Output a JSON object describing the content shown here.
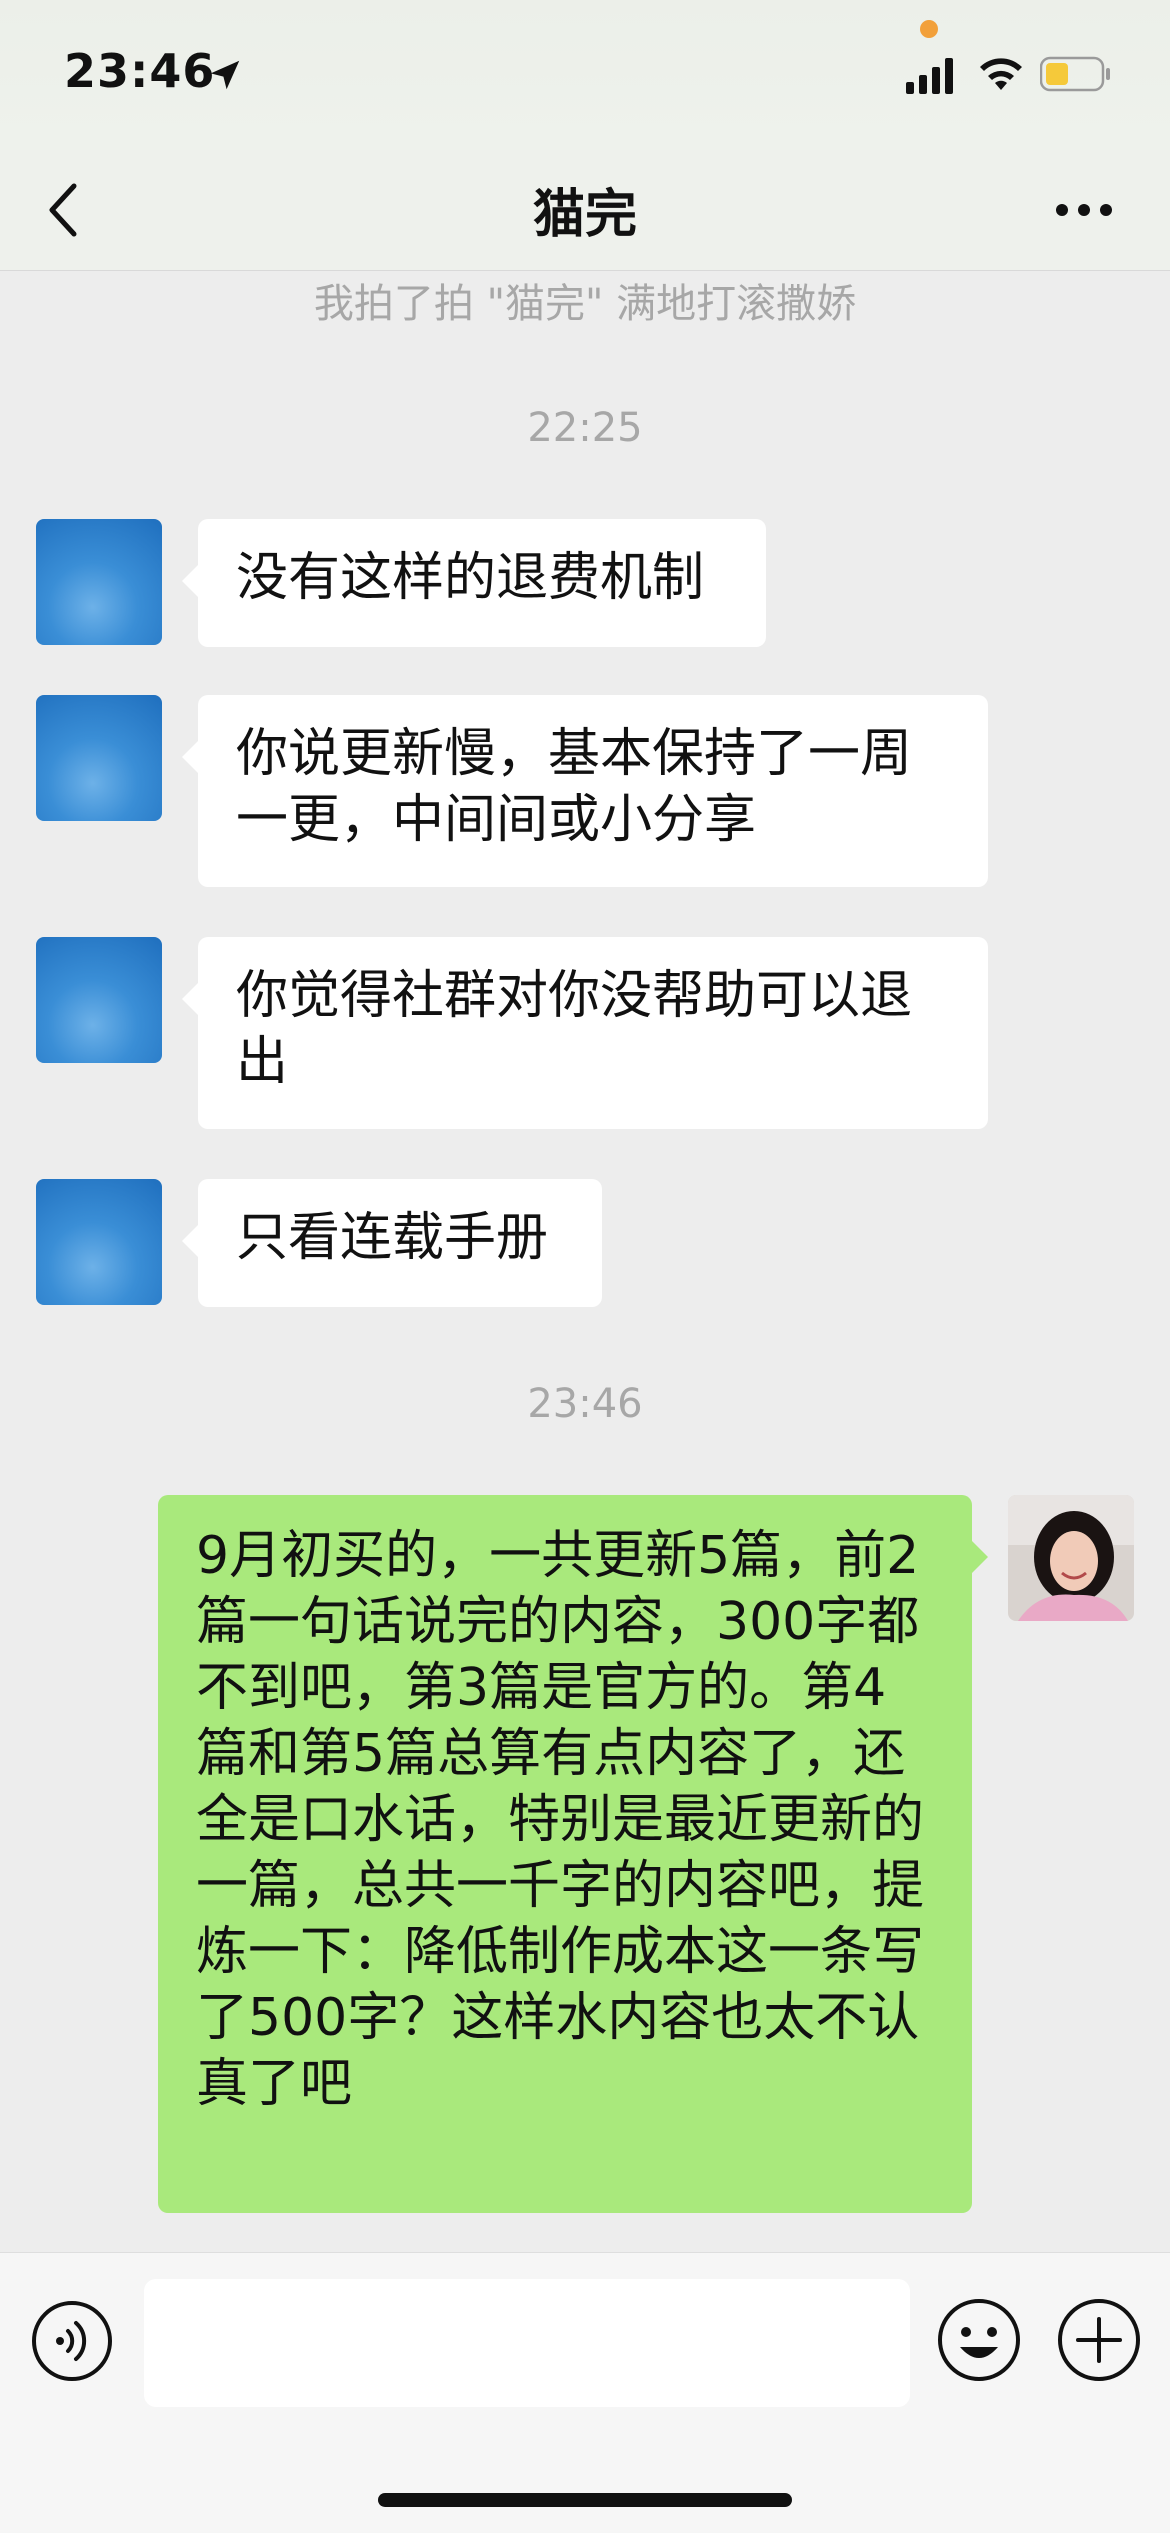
{
  "status_bar": {
    "time": "23:46"
  },
  "nav": {
    "title": "猫完"
  },
  "chat": {
    "system_message": "我拍了拍 \"猫完\" 满地打滚撒娇",
    "timestamp_1": "22:25",
    "incoming": [
      {
        "text": "没有这样的退费机制"
      },
      {
        "text": "你说更新慢，基本保持了一周一更，中间间或小分享"
      },
      {
        "text": "你觉得社群对你没帮助可以退出"
      },
      {
        "text": "只看连载手册"
      }
    ],
    "timestamp_2": "23:46",
    "outgoing": [
      {
        "text": "9月初买的，一共更新5篇，前2篇一句话说完的内容，300字都不到吧，第3篇是官方的。第4篇和第5篇总算有点内容了，还全是口水话，特别是最近更新的一篇，总共一千字的内容吧，提炼一下：降低制作成本这一条写了500字？这样水内容也太不认真了吧"
      }
    ]
  },
  "colors": {
    "incoming_bubble": "#ffffff",
    "outgoing_bubble": "#a9e97c",
    "background": "#ededed"
  },
  "icons": [
    "location-arrow-icon",
    "signal-icon",
    "wifi-icon",
    "battery-icon",
    "back-chevron-icon",
    "more-dots-icon",
    "voice-icon",
    "emoji-icon",
    "plus-icon"
  ]
}
